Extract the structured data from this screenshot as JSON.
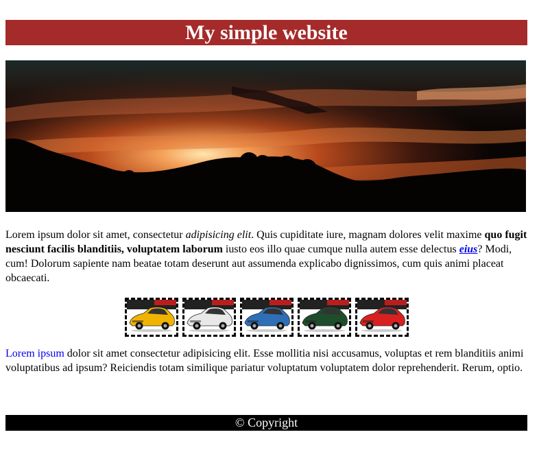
{
  "header": {
    "title": "My simple website"
  },
  "intro": {
    "t1": "Lorem ipsum dolor sit amet, consectetur ",
    "italic": "adipisicing elit",
    "t2": ". Quis cupiditate iure, magnam dolores velit maxime ",
    "bold": "quo fugit nesciunt facilis blanditiis, voluptatem laborum",
    "t3": " iusto eos illo quae cumque nulla autem esse delectus ",
    "link": "eius",
    "t4": "? Modi, cum! Dolorum sapiente nam beatae totam deserunt aut assumenda explicabo dignissimos, cum quis animi placeat obcaecati."
  },
  "gallery": {
    "cars": [
      {
        "color": "#f0b400"
      },
      {
        "color": "#e8e8e8"
      },
      {
        "color": "#2f6fb8"
      },
      {
        "color": "#1e4d2b"
      },
      {
        "color": "#d92020"
      }
    ]
  },
  "second": {
    "link": "Lorem ipsum",
    "text": " dolor sit amet consectetur adipisicing elit. Esse mollitia nisi accusamus, voluptas et rem blanditiis animi voluptatibus ad ipsum? Reiciendis totam similique pariatur voluptatum voluptatem dolor reprehenderit. Rerum, optio."
  },
  "footer": {
    "text": "© Copyright"
  },
  "colors": {
    "header_bg": "#a52a2a",
    "footer_bg": "#000000",
    "link": "#0000ee"
  }
}
